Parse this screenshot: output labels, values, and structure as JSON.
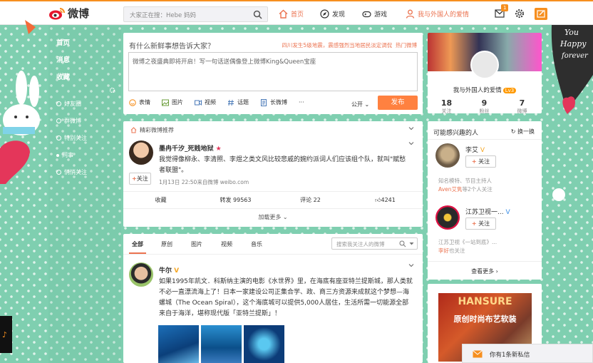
{
  "topbar": {
    "logo_text": "微博",
    "search_placeholder": "大家正在搜：Hebe 妈妈",
    "nav": [
      {
        "label": "首页",
        "icon": "home-icon"
      },
      {
        "label": "发现",
        "icon": "compass-icon"
      },
      {
        "label": "游戏",
        "icon": "gamepad-icon"
      },
      {
        "label": "我与外国人的爱情",
        "icon": "user-icon"
      }
    ],
    "message_count": "1"
  },
  "leftnav": {
    "main": [
      "首页",
      "消息",
      "收藏"
    ],
    "sub": [
      "好友圈",
      "群微博",
      "特别关注",
      "同事",
      "悄悄关注"
    ]
  },
  "publisher": {
    "title": "有什么新鲜事想告诉大家？",
    "title_bold": "新鲜事",
    "hot_topic": "四川发生5级地震，震感强烈当地居民淡定调侃",
    "hot_label": "热门微博",
    "textarea_text": "微博之夜盛典即将开启！写一句话送偶像登上微博King&Queen宝座",
    "tools": [
      "表情",
      "图片",
      "视频",
      "话题",
      "长微博",
      "···"
    ],
    "visibility": "公开",
    "submit": "发布"
  },
  "recommend": {
    "header": "精彩微博推荐",
    "author": "墨冉千汐_死贱地狱",
    "follow": "关注",
    "text": "我觉得像柳永、李清照、李煜之类文风比较悲戚的婉约派词人们应该组个队，就叫\"赋愁者联盟\"。",
    "meta": "1月13日 22:50来自微博 weibo.com",
    "actions": [
      "收藏",
      "转发 99563",
      "评论 22",
      "4241"
    ],
    "load_more": "加载更多"
  },
  "feed": {
    "tabs": [
      "全部",
      "原创",
      "图片",
      "视频",
      "音乐"
    ],
    "search_placeholder": "搜索我关注人的微博",
    "post": {
      "author": "牛尔",
      "text": "如果1995年凯文．科斯纳主演的电影《水世界》里，在海底有座亚特兰提斯城，那人类就不必一直漂流海上了！日本一家建设公司正集合学、政、商三方资源来成就这个梦想—海螺城（The Ocean Spiral），这个海底城可以提供5,000人居住，生活所需一切能源全部来自于海洋，堪称现代版「亚特兰提斯」！"
    }
  },
  "profile": {
    "name": "我与外国人的爱情",
    "level": "Lv3",
    "stats": [
      {
        "n": "18",
        "l": "关注"
      },
      {
        "n": "9",
        "l": "粉丝"
      },
      {
        "n": "7",
        "l": "微博"
      }
    ]
  },
  "interests": {
    "title": "可能感兴趣的人",
    "refresh": "换一换",
    "people": [
      {
        "name": "李艾",
        "follow": "关注",
        "desc1": "知名模特、节目主持人",
        "desc_link": "Aven艾隽",
        "desc2": "等2个人关注"
      },
      {
        "name": "江苏卫视一...",
        "follow": "关注",
        "desc1": "江苏卫视《一站到底》...",
        "desc_link": "李好",
        "desc2": "也关注"
      }
    ],
    "see_more": "查看更多"
  },
  "ad": {
    "brand": "HANSURE",
    "slogan": "原创时尚布艺软装"
  },
  "private_msg": "你有1条新私信",
  "colors": {
    "accent": "#eb7350",
    "orange": "#f68f1f",
    "background": "#7fcfb0"
  }
}
